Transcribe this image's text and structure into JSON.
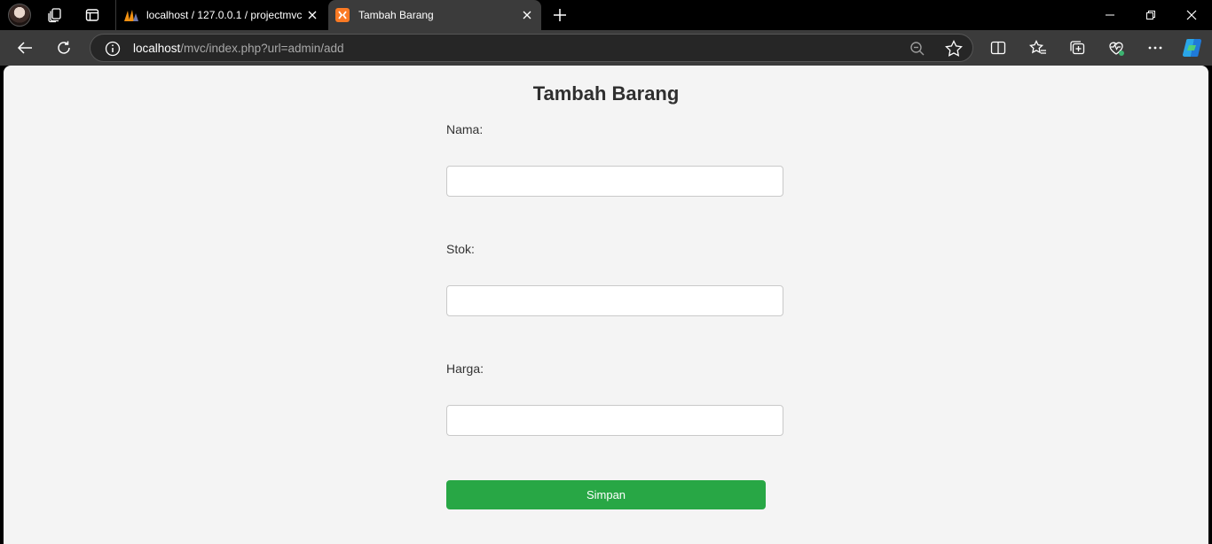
{
  "browser": {
    "tabs": [
      {
        "title": "localhost / 127.0.0.1 / projectmvc",
        "favicon": "phpmyadmin-icon",
        "active": false
      },
      {
        "title": "Tambah Barang",
        "favicon": "xampp-icon",
        "active": true
      }
    ],
    "address": {
      "host": "localhost",
      "path": "/mvc/index.php?url=admin/add"
    }
  },
  "page": {
    "title": "Tambah Barang",
    "fields": [
      {
        "label": "Nama:",
        "value": ""
      },
      {
        "label": "Stok:",
        "value": ""
      },
      {
        "label": "Harga:",
        "value": ""
      }
    ],
    "submit_label": "Simpan"
  },
  "colors": {
    "submit": "#28a745",
    "page_bg": "#f4f4f4",
    "toolbar_bg": "#3b3b3b",
    "tabstrip_bg": "#000000"
  }
}
